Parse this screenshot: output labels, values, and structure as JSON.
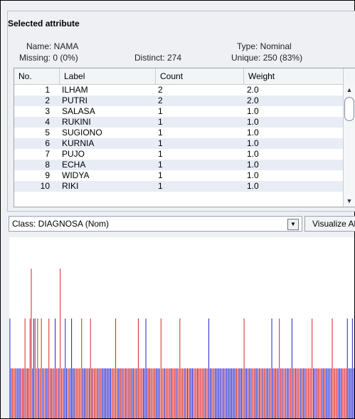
{
  "panel": {
    "title": "Selected attribute",
    "name": "Name: NAMA",
    "type": "Type: Nominal",
    "missing": "Missing: 0 (0%)",
    "distinct": "Distinct: 274",
    "unique": "Unique: 250 (83%)"
  },
  "table": {
    "headers": [
      "No.",
      "Label",
      "Count",
      "Weight"
    ],
    "rows": [
      {
        "no": "1",
        "label": "ILHAM",
        "count": "2",
        "weight": "2.0"
      },
      {
        "no": "2",
        "label": "PUTRI",
        "count": "2",
        "weight": "2.0"
      },
      {
        "no": "3",
        "label": "SALASA",
        "count": "1",
        "weight": "1.0"
      },
      {
        "no": "4",
        "label": "RUKINI",
        "count": "1",
        "weight": "1.0"
      },
      {
        "no": "5",
        "label": "SUGIONO",
        "count": "1",
        "weight": "1.0"
      },
      {
        "no": "6",
        "label": "KURNIA",
        "count": "1",
        "weight": "1.0"
      },
      {
        "no": "7",
        "label": "PUJO",
        "count": "1",
        "weight": "1.0"
      },
      {
        "no": "8",
        "label": "ECHA",
        "count": "1",
        "weight": "1.0"
      },
      {
        "no": "9",
        "label": "WIDYA",
        "count": "1",
        "weight": "1.0"
      },
      {
        "no": "10",
        "label": "RIKI",
        "count": "1",
        "weight": "1.0"
      }
    ]
  },
  "class_bar": {
    "selected": "Class: DIAGNOSA (Nom)",
    "visualize_label": "Visualize All"
  },
  "colors": {
    "red": "#d81b1b",
    "blue": "#1a1ac8",
    "row_alt": "#e8edf5"
  },
  "chart_data": {
    "type": "bar",
    "categories_count": 274,
    "series": [
      {
        "values_pattern": "mostly count 1 per label, a few labels with count 2 or 3"
      }
    ],
    "xlabel": "",
    "ylabel": ""
  }
}
